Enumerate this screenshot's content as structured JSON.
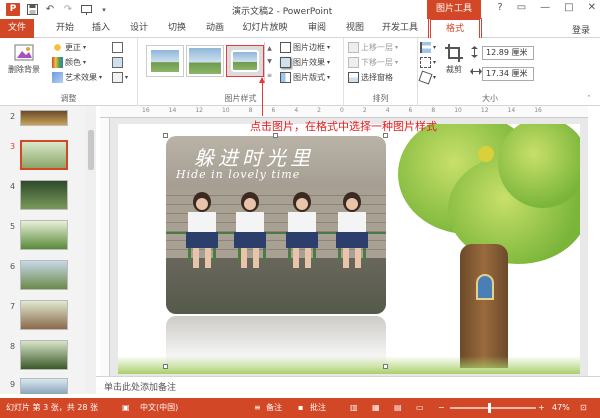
{
  "titlebar": {
    "title": "演示文稿2 - PowerPoint",
    "context_tab": "图片工具",
    "window_controls": [
      "?",
      "▭",
      "—",
      "□",
      "✕"
    ]
  },
  "tabs": [
    {
      "label": "文件",
      "active": false
    },
    {
      "label": "开始",
      "active": false
    },
    {
      "label": "插入",
      "active": false
    },
    {
      "label": "设计",
      "active": false
    },
    {
      "label": "切换",
      "active": false
    },
    {
      "label": "动画",
      "active": false
    },
    {
      "label": "幻灯片放映",
      "active": false
    },
    {
      "label": "审阅",
      "active": false
    },
    {
      "label": "视图",
      "active": false
    },
    {
      "label": "开发工具",
      "active": false
    },
    {
      "label": "格式",
      "active": true
    }
  ],
  "login_label": "登录",
  "ribbon": {
    "adjust": {
      "remove_bg": "删除背景",
      "correct": "更正",
      "color": "颜色",
      "art_effects": "艺术效果",
      "label": "调整"
    },
    "styles": {
      "label": "图片样式",
      "border": "图片边框",
      "effects": "图片效果",
      "layout": "图片版式"
    },
    "arrange": {
      "bring_forward": "上移一层",
      "send_backward": "下移一层",
      "selection_pane": "选择窗格",
      "label": "排列"
    },
    "size": {
      "crop": "裁剪",
      "height": "12.89 厘米",
      "width": "17.34 厘米",
      "label": "大小"
    }
  },
  "ruler": {
    "ticks": [
      "16",
      "14",
      "12",
      "10",
      "8",
      "6",
      "4",
      "2",
      "0",
      "2",
      "4",
      "6",
      "8",
      "10",
      "12",
      "14",
      "16"
    ]
  },
  "thumbnails": [
    {
      "num": "2"
    },
    {
      "num": "3"
    },
    {
      "num": "4"
    },
    {
      "num": "5"
    },
    {
      "num": "6"
    },
    {
      "num": "7"
    },
    {
      "num": "8"
    },
    {
      "num": "9"
    }
  ],
  "slide": {
    "handwriting_cn": "躲进时光里",
    "handwriting_en": "Hide in lovely time"
  },
  "annotation": "点击图片，在格式中选择一种图片样式",
  "notes_placeholder": "单击此处添加备注",
  "statusbar": {
    "slide_info": "幻灯片 第 3 张，共 28 张",
    "language": "中文(中国)",
    "notes": "备注",
    "comments": "批注",
    "zoom": "47%"
  },
  "colors": {
    "accent": "#d24726",
    "highlight": "#e23a3a"
  }
}
